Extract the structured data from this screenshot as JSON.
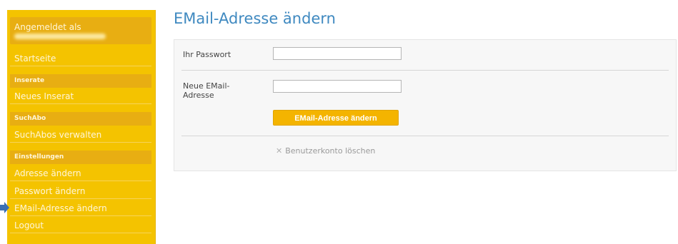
{
  "sidebar": {
    "logged_in_label": "Angemeldet als",
    "nav_startseite": "Startseite",
    "section_inserate": "Inserate",
    "nav_neues_inserat": "Neues Inserat",
    "section_suchabo": "SuchAbo",
    "nav_suchabos_verwalten": "SuchAbos verwalten",
    "section_einstellungen": "Einstellungen",
    "nav_adresse_aendern": "Adresse ändern",
    "nav_passwort_aendern": "Passwort ändern",
    "nav_email_adresse_aendern": "EMail-Adresse ändern",
    "nav_logout": "Logout"
  },
  "main": {
    "title": "EMail-Adresse ändern",
    "form": {
      "password_label": "Ihr Passwort",
      "password_value": "",
      "new_email_label": "Neue EMail-Adresse",
      "new_email_value": "",
      "submit_label": "EMail-Adresse ändern",
      "delete_account_label": "Benutzerkonto löschen"
    }
  },
  "colors": {
    "sidebar_bg": "#f4c300",
    "section_bg": "#e8ae12",
    "title_blue": "#3f89c0",
    "button_bg": "#f4b400",
    "marker_arrow": "#3b6fb3"
  },
  "icons": {
    "current_page_marker": "arrow-right-icon",
    "delete": "close-icon"
  }
}
